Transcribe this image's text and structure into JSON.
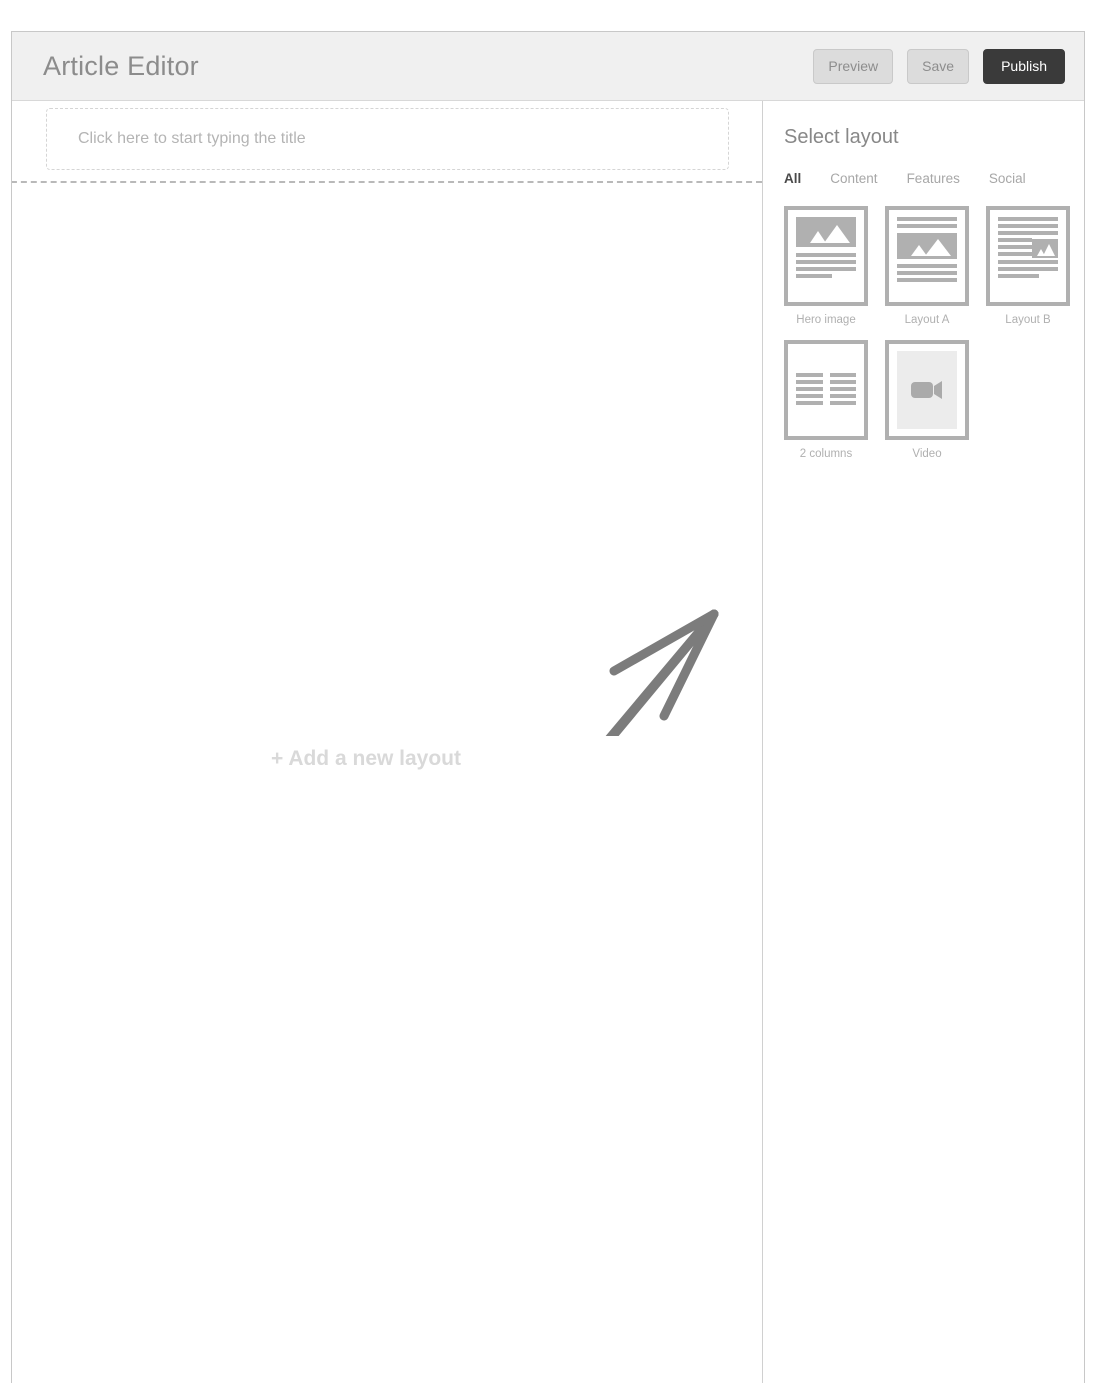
{
  "header": {
    "title": "Article Editor",
    "buttons": [
      {
        "label": "Preview",
        "style": "secondary"
      },
      {
        "label": "Save",
        "style": "secondary"
      },
      {
        "label": "Publish",
        "style": "primary"
      }
    ]
  },
  "canvas": {
    "title_placeholder": "Click here to start typing the title",
    "title_value": "",
    "add_layout_label": "+ Add a new layout",
    "pointer_arrow": "hand-drawn arrow pointing up-right toward layout panel"
  },
  "sidebar": {
    "heading": "Select layout",
    "tabs": [
      {
        "label": "All",
        "active": true
      },
      {
        "label": "Content",
        "active": false
      },
      {
        "label": "Features",
        "active": false
      },
      {
        "label": "Social",
        "active": false
      }
    ],
    "layouts": [
      {
        "id": "hero",
        "label": "Hero image"
      },
      {
        "id": "layout-a",
        "label": "Layout A"
      },
      {
        "id": "layout-b",
        "label": "Layout B"
      },
      {
        "id": "two-columns",
        "label": "2 columns"
      },
      {
        "id": "video",
        "label": "Video"
      }
    ]
  },
  "colors": {
    "header_bg": "#f0f0f0",
    "title_text": "#8c8c8c",
    "publish_bg": "#3a3a3a",
    "secondary_btn_bg": "#dcdcdc",
    "thumb_gray": "#b0b0b0",
    "placeholder_gray": "#b4b4b4",
    "add_layout_gray": "#d9d9d9",
    "arrow_gray": "#7c7c7c",
    "window_border": "#c8c8c8"
  }
}
